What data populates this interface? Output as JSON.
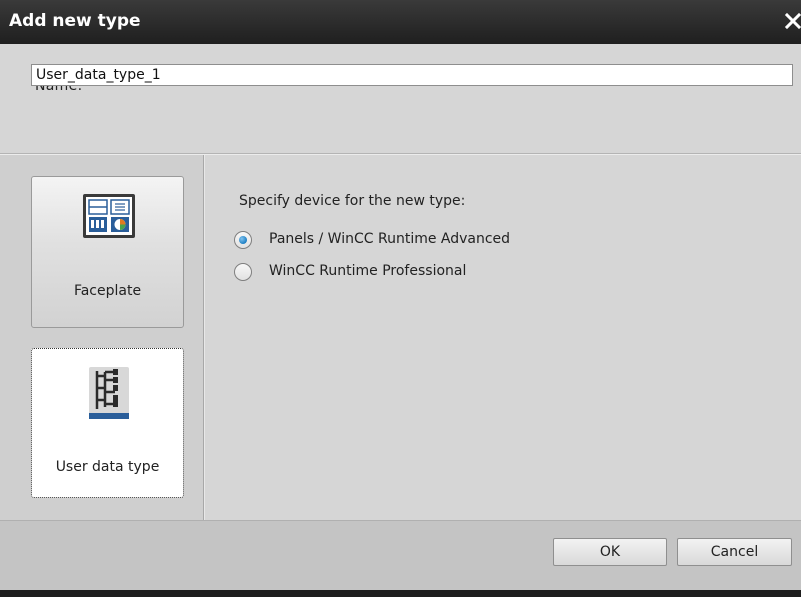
{
  "dialog": {
    "title": "Add new type",
    "close_icon": "close-icon"
  },
  "name_section": {
    "label": "Name:",
    "value": "User_data_type_1"
  },
  "type_buttons": [
    {
      "label": "Faceplate",
      "icon": "faceplate-icon",
      "selected": false
    },
    {
      "label": "User data type",
      "icon": "user-data-type-icon",
      "selected": true
    }
  ],
  "device_section": {
    "prompt": "Specify device for the new type:",
    "options": [
      {
        "label": "Panels / WinCC Runtime Advanced",
        "checked": true
      },
      {
        "label": "WinCC Runtime Professional",
        "checked": false
      }
    ]
  },
  "footer": {
    "ok_label": "OK",
    "cancel_label": "Cancel"
  },
  "colors": {
    "title_bar": "#2b2b2b",
    "dialog_background": "#d6d6d6",
    "radio_accent": "#1e7fc4"
  }
}
